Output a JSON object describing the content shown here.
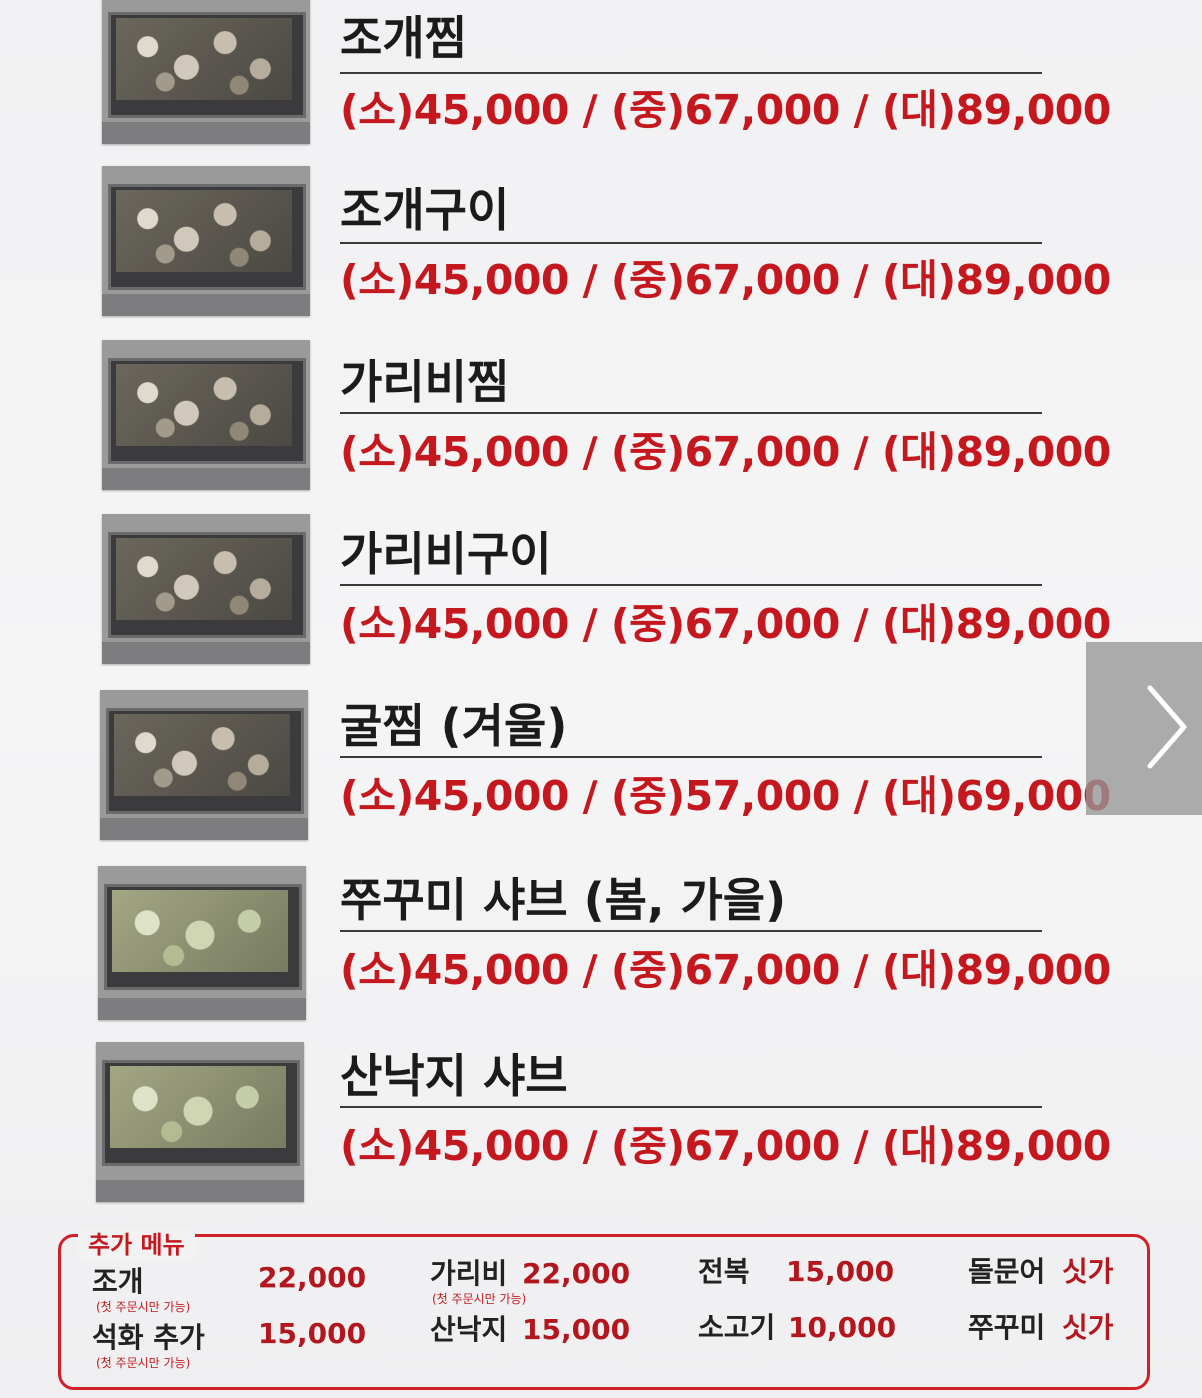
{
  "menu_items": [
    {
      "name": "조개찜",
      "price": "(소)45,000 / (중)67,000 / (대)89,000",
      "photo": "steamed-clams-photo"
    },
    {
      "name": "조개구이",
      "price": "(소)45,000 / (중)67,000 / (대)89,000",
      "photo": "grilled-clams-photo"
    },
    {
      "name": "가리비찜",
      "price": "(소)45,000 / (중)67,000 / (대)89,000",
      "photo": "steamed-scallops-photo"
    },
    {
      "name": "가리비구이",
      "price": "(소)45,000 / (중)67,000 / (대)89,000",
      "photo": "grilled-scallops-photo"
    },
    {
      "name": "굴찜 (겨울)",
      "price": "(소)45,000 / (중)57,000 / (대)69,000",
      "photo": "steamed-oysters-photo"
    },
    {
      "name": "쭈꾸미 샤브 (봄, 가을)",
      "price": "(소)45,000 / (중)67,000 / (대)89,000",
      "photo": "webfoot-octopus-shabu-photo"
    },
    {
      "name": "산낙지 샤브",
      "price": "(소)45,000 / (중)67,000 / (대)89,000",
      "photo": "live-octopus-shabu-photo"
    }
  ],
  "extra_menu": {
    "title": "추가 메뉴",
    "items": [
      {
        "name": "조개",
        "price": "22,000",
        "note": "(첫 주문시만 가능)"
      },
      {
        "name": "석화 추가",
        "price": "15,000",
        "note": "(첫 주문시만 가능)"
      },
      {
        "name": "가리비",
        "price": "22,000",
        "note": "(첫 주문시만 가능)"
      },
      {
        "name": "산낙지",
        "price": "15,000",
        "note": ""
      },
      {
        "name": "전복",
        "price": "15,000",
        "note": ""
      },
      {
        "name": "소고기",
        "price": "10,000",
        "note": ""
      },
      {
        "name": "돌문어",
        "price": "싯가",
        "note": ""
      },
      {
        "name": "쭈꾸미",
        "price": "싯가",
        "note": ""
      }
    ]
  },
  "navigation": {
    "next_icon": "chevron-right-icon"
  },
  "colors": {
    "price_red": "#c5181e",
    "title_black": "#1b1b1b",
    "box_border": "#d02027"
  }
}
